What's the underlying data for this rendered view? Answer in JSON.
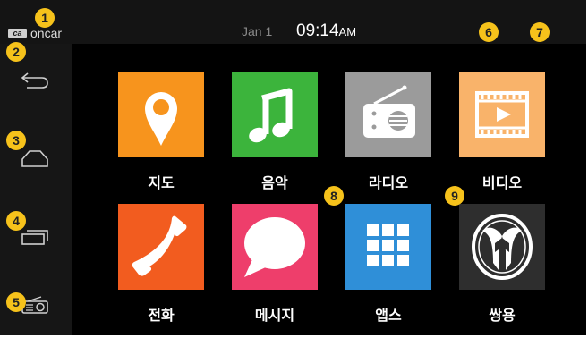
{
  "statusbar": {
    "brand_mark": "ca",
    "brand_name": "oncar",
    "date": "Jan 1",
    "time": "09:14",
    "ampm": "AM"
  },
  "markers": [
    "1",
    "2",
    "3",
    "4",
    "5",
    "6",
    "7",
    "8",
    "9"
  ],
  "apps": [
    {
      "label": "지도",
      "icon": "map-pin-icon",
      "color": "#f7941d"
    },
    {
      "label": "음악",
      "icon": "music-note-icon",
      "color": "#3cb43c"
    },
    {
      "label": "라디오",
      "icon": "radio-icon",
      "color": "#9b9b9b"
    },
    {
      "label": "비디오",
      "icon": "video-icon",
      "color": "#f9b36a"
    },
    {
      "label": "전화",
      "icon": "phone-icon",
      "color": "#f25c1f"
    },
    {
      "label": "메시지",
      "icon": "chat-bubble-icon",
      "color": "#ee3e6b"
    },
    {
      "label": "앱스",
      "icon": "apps-grid-icon",
      "color": "#2f8fd8"
    },
    {
      "label": "쌍용",
      "icon": "ssangyong-logo-icon",
      "color": "#2e2e2e"
    }
  ]
}
